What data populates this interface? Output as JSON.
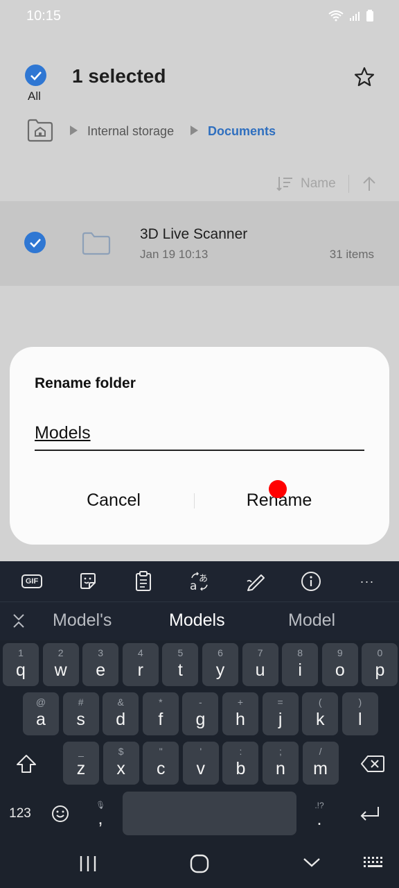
{
  "status": {
    "time": "10:15"
  },
  "header": {
    "title": "1 selected",
    "all_label": "All"
  },
  "breadcrumb": {
    "items": [
      "Internal storage",
      "Documents"
    ]
  },
  "sort": {
    "label": "Name"
  },
  "file": {
    "name": "3D Live Scanner",
    "date": "Jan 19 10:13",
    "count": "31 items"
  },
  "dialog": {
    "title": "Rename folder",
    "input_value": "Models",
    "cancel_label": "Cancel",
    "rename_label": "Rename"
  },
  "keyboard": {
    "toolbar": [
      "gif-icon",
      "sticker-icon",
      "clipboard-icon",
      "translate-icon",
      "handwriting-icon",
      "info-icon",
      "more-icon"
    ],
    "gif_text": "GIF",
    "more_text": "···",
    "suggestions": [
      "Model's",
      "Models",
      "Model"
    ],
    "row1": [
      [
        "1",
        "q"
      ],
      [
        "2",
        "w"
      ],
      [
        "3",
        "e"
      ],
      [
        "4",
        "r"
      ],
      [
        "5",
        "t"
      ],
      [
        "6",
        "y"
      ],
      [
        "7",
        "u"
      ],
      [
        "8",
        "i"
      ],
      [
        "9",
        "o"
      ],
      [
        "0",
        "p"
      ]
    ],
    "row2": [
      [
        "@",
        "a"
      ],
      [
        "#",
        "s"
      ],
      [
        "&",
        "d"
      ],
      [
        "*",
        "f"
      ],
      [
        "-",
        "g"
      ],
      [
        "+",
        "h"
      ],
      [
        "=",
        "j"
      ],
      [
        "(",
        "k"
      ],
      [
        ")",
        "l"
      ]
    ],
    "row3": [
      [
        "_",
        "z"
      ],
      [
        "$",
        "x"
      ],
      [
        "\"",
        "c"
      ],
      [
        "'",
        "v"
      ],
      [
        ":",
        "b"
      ],
      [
        ";",
        "n"
      ],
      [
        "/",
        "m"
      ]
    ],
    "num_label": "123",
    "comma_label": ",",
    "comma_hint": "🎙",
    "period_label": ".",
    "period_hint": ".!?"
  },
  "colors": {
    "accent": "#2f77d3",
    "keyboard_bg": "#1c222c",
    "key_bg": "#3a4049"
  }
}
